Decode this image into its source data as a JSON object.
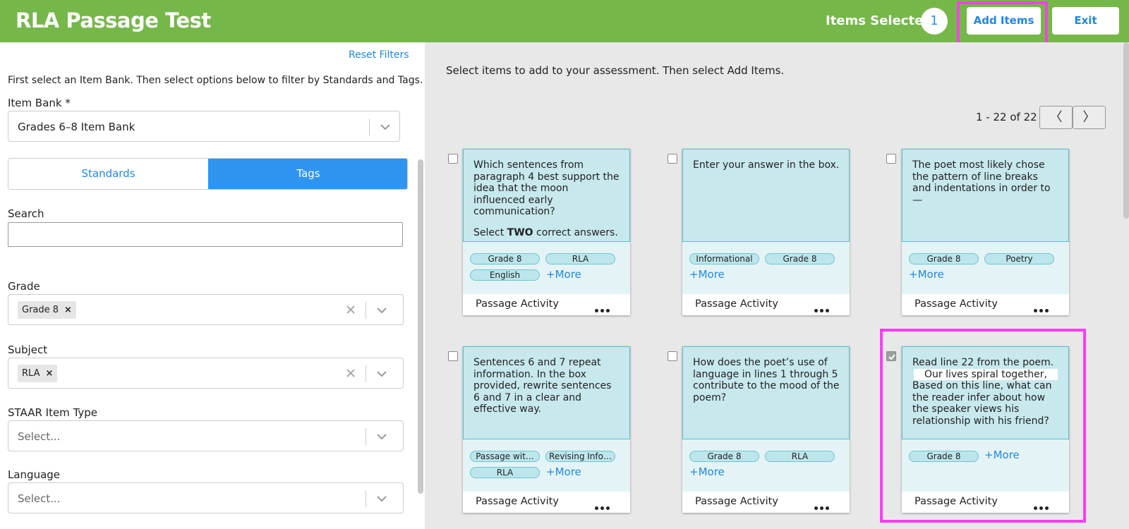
{
  "header": {
    "title": "RLA Passage Test",
    "items_selected_label": "Items Selected",
    "items_selected_count": "1",
    "add_items_label": "Add Items",
    "exit_label": "Exit"
  },
  "sidebar": {
    "reset_filters": "Reset Filters",
    "instructions": "First select an Item Bank. Then select options below to filter by Standards and Tags.",
    "item_bank_label": "Item Bank *",
    "item_bank_value": "Grades 6–8 Item Bank",
    "tabs": {
      "standards": "Standards",
      "tags": "Tags",
      "active": "Tags"
    },
    "search_label": "Search",
    "search_value": "",
    "grade_label": "Grade",
    "grade_chip": "Grade 8",
    "subject_label": "Subject",
    "subject_chip": "RLA",
    "item_type_label": "STAAR Item Type",
    "item_type_placeholder": "Select...",
    "language_label": "Language",
    "language_placeholder": "Select..."
  },
  "main": {
    "instructions": "Select items to add to your assessment. Then select Add Items.",
    "pager_text": "1 - 22 of 22",
    "prev_glyph": "〈",
    "next_glyph": "〉",
    "cards": [
      {
        "stem": [
          "Which sentences from paragraph 4 best support the idea that the moon influenced early communication?"
        ],
        "stem_extra": {
          "before": "Select ",
          "bold": "TWO",
          "after": " correct answers."
        },
        "tags": [
          "Grade 8",
          "RLA",
          "English"
        ],
        "more": "+More",
        "type": "Passage Activity",
        "checked": false
      },
      {
        "stem": [
          "Enter your answer in the box."
        ],
        "tags": [
          "Informational",
          "Grade 8"
        ],
        "more": "+More",
        "type": "Passage Activity",
        "checked": false
      },
      {
        "stem": [
          "The poet most likely chose the pattern of line breaks and indentations in order to —"
        ],
        "tags": [
          "Grade 8",
          "Poetry"
        ],
        "more": "+More",
        "type": "Passage Activity",
        "checked": false
      },
      {
        "stem": [
          "Sentences 6 and 7 repeat information. In the box provided, rewrite sentences 6 and 7 in a clear and effective way."
        ],
        "tags": [
          "Passage wit…",
          "Revising Info…",
          "RLA"
        ],
        "more": "+More",
        "type": "Passage Activity",
        "checked": false
      },
      {
        "stem": [
          "How does the poet’s use of language in lines 1 through 5 contribute to the mood of the poem?"
        ],
        "tags": [
          "Grade 8",
          "RLA"
        ],
        "more": "+More",
        "type": "Passage Activity",
        "checked": false
      },
      {
        "stem": [
          "Read line 22 from the poem."
        ],
        "quote": "Our lives spiral together,",
        "stem_after": "Based on this line, what can the reader infer about how the speaker views his relationship with his friend?",
        "tags": [
          "Grade 8"
        ],
        "more": "+More",
        "type": "Passage Activity",
        "checked": true
      }
    ]
  },
  "colors": {
    "header_green": "#76b74a",
    "accent_blue": "#1e88e5",
    "active_tab": "#2e94f0",
    "highlight_magenta": "#ff3cf0",
    "card_stem_bg": "#c7e8ed",
    "tag_bg": "#bde6ec"
  }
}
